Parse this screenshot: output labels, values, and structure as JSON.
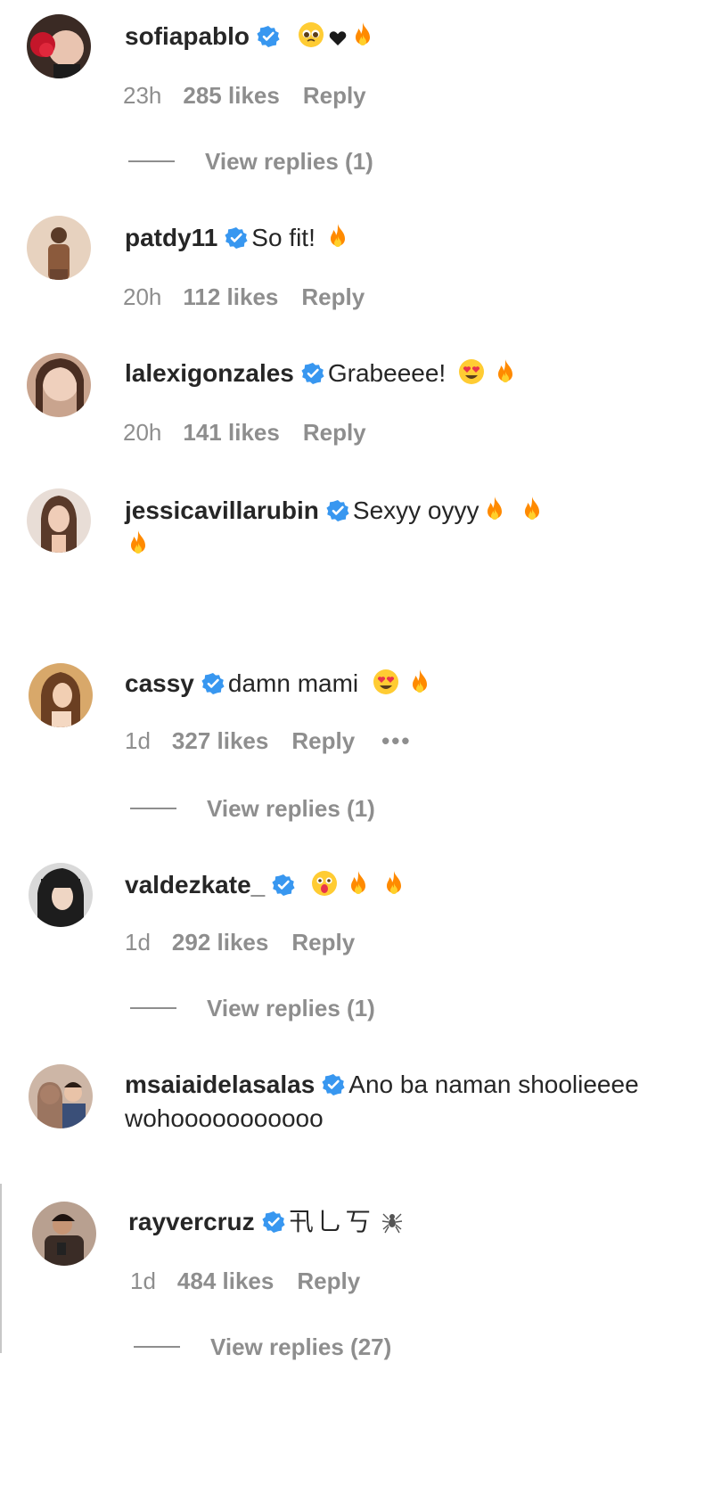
{
  "comments": [
    {
      "username": "sofiapablo",
      "text": "",
      "emojis": [
        "pleading",
        "heart",
        "fire"
      ],
      "time": "23h",
      "likes": "285 likes",
      "reply": "Reply",
      "view_replies": "View replies (1)"
    },
    {
      "username": "patdy11",
      "text": "So fit!",
      "emojis": [
        "fire"
      ],
      "time": "20h",
      "likes": "112 likes",
      "reply": "Reply"
    },
    {
      "username": "lalexigonzales",
      "text": "Grabeeee!",
      "emojis": [
        "heart-eyes",
        "fire"
      ],
      "time": "20h",
      "likes": "141 likes",
      "reply": "Reply"
    },
    {
      "username": "jessicavillarubin",
      "text": "Sexyy oyyy",
      "emojis": [
        "fire",
        "fire"
      ],
      "line2_emojis": [
        "fire"
      ]
    },
    {
      "username": "cassy",
      "text": "damn mami",
      "emojis": [
        "heart-eyes",
        "fire"
      ],
      "time": "1d",
      "likes": "327 likes",
      "reply": "Reply",
      "more": "•••",
      "view_replies": "View replies (1)"
    },
    {
      "username": "valdezkate_",
      "text": "",
      "emojis": [
        "astonished",
        "fire",
        "fire"
      ],
      "time": "1d",
      "likes": "292 likes",
      "reply": "Reply",
      "view_replies": "View replies (1)"
    },
    {
      "username": "msaiaidelasalas",
      "text": "Ano ba naman shoolieeee",
      "text_line2": "wohooooooooooo"
    },
    {
      "username": "rayvercruz",
      "text": "卂乚丂",
      "emojis": [
        "spider"
      ],
      "time": "1d",
      "likes": "484 likes",
      "reply": "Reply",
      "view_replies": "View replies (27)"
    }
  ],
  "colors": {
    "verified": "#3897f0",
    "fire": "#ff8a00",
    "muted": "#8e8e8e",
    "text": "#262626"
  },
  "icons": {
    "verified": "verified-badge-icon",
    "fire": "fire-emoji-icon",
    "heart_eyes": "heart-eyes-emoji-icon",
    "pleading": "pleading-face-emoji-icon",
    "astonished": "astonished-face-emoji-icon",
    "heart": "black-heart-icon",
    "spider": "spider-emoji-icon",
    "more": "more-options-icon"
  }
}
